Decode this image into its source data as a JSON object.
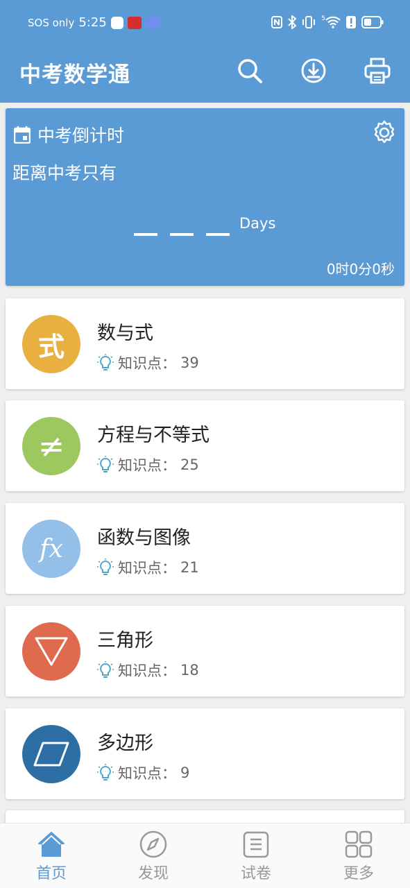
{
  "status_bar": {
    "carrier": "SOS only",
    "time": "5:25",
    "network_tag": "5"
  },
  "app_bar": {
    "title": "中考数学通",
    "actions": [
      "search-icon",
      "download-icon",
      "print-icon"
    ]
  },
  "countdown": {
    "title": "中考倒计时",
    "subtitle": "距离中考只有",
    "days_unit": "Days",
    "remaining": "0时0分0秒"
  },
  "topics": [
    {
      "name": "数与式",
      "meta_label": "知识点：",
      "count": "39",
      "icon_text": "式",
      "color": "#e8b040"
    },
    {
      "name": "方程与不等式",
      "meta_label": "知识点：",
      "count": "25",
      "icon_text": "≠",
      "color": "#9dc860"
    },
    {
      "name": "函数与图像",
      "meta_label": "知识点：",
      "count": "21",
      "icon_text": "fx",
      "color": "#94bfe8"
    },
    {
      "name": "三角形",
      "meta_label": "知识点：",
      "count": "18",
      "icon_text": "",
      "color": "#e06a4e"
    },
    {
      "name": "多边形",
      "meta_label": "知识点：",
      "count": "9",
      "icon_text": "",
      "color": "#2d6fa4"
    }
  ],
  "bottom_nav": [
    {
      "label": "首页",
      "icon": "home-icon",
      "active": true
    },
    {
      "label": "发现",
      "icon": "compass-icon",
      "active": false
    },
    {
      "label": "试卷",
      "icon": "paper-icon",
      "active": false
    },
    {
      "label": "更多",
      "icon": "grid-icon",
      "active": false
    }
  ],
  "colors": {
    "primary": "#5b9bd5",
    "inactive": "#999999",
    "bulb": "#4aa8c8"
  }
}
